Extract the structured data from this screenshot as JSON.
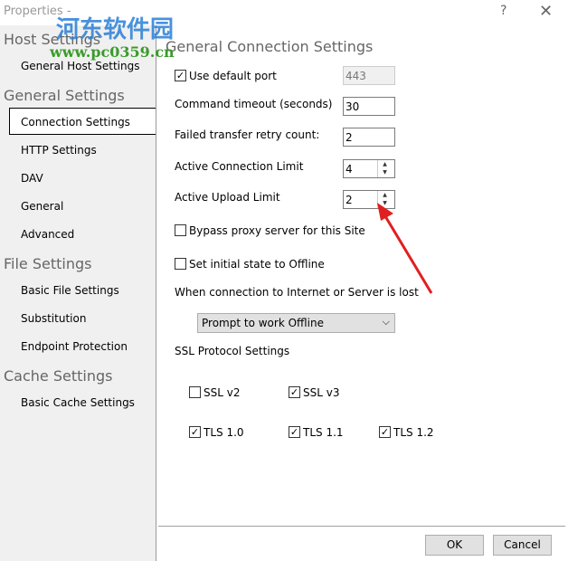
{
  "window": {
    "title": "Properties -",
    "help": "?",
    "close": "✕"
  },
  "watermark": {
    "text": "河东软件园",
    "url": "www.pc0359.cn"
  },
  "sidebar": {
    "groups": [
      {
        "label": "Host Settings",
        "items": [
          "General Host Settings"
        ]
      },
      {
        "label": "General Settings",
        "items": [
          "Connection Settings",
          "HTTP Settings",
          "DAV",
          "General",
          "Advanced"
        ]
      },
      {
        "label": "File Settings",
        "items": [
          "Basic File Settings",
          "Substitution",
          "Endpoint Protection"
        ]
      },
      {
        "label": "Cache Settings",
        "items": [
          "Basic Cache Settings"
        ]
      }
    ],
    "selected": "Connection Settings"
  },
  "main": {
    "heading": "General Connection Settings",
    "use_default_port": {
      "label": "Use default port",
      "checked": true,
      "value": "443"
    },
    "command_timeout": {
      "label": "Command timeout (seconds)",
      "value": "30"
    },
    "retry_count": {
      "label": "Failed transfer retry count:",
      "value": "2"
    },
    "connection_limit": {
      "label": "Active Connection Limit",
      "value": "4"
    },
    "upload_limit": {
      "label": "Active Upload Limit",
      "value": "2"
    },
    "bypass_proxy": {
      "label": "Bypass proxy server for this Site",
      "checked": false
    },
    "offline": {
      "label": "Set initial state to Offline",
      "checked": false
    },
    "lost_label": "When connection to Internet or Server is lost",
    "lost_select": "Prompt to work Offline",
    "ssl_heading": "SSL Protocol Settings",
    "ssl": [
      {
        "label": "SSL v2",
        "checked": false
      },
      {
        "label": "SSL v3",
        "checked": true
      },
      {
        "label": "TLS 1.0",
        "checked": true
      },
      {
        "label": "TLS 1.1",
        "checked": true
      },
      {
        "label": "TLS 1.2",
        "checked": true
      }
    ]
  },
  "buttons": {
    "ok": "OK",
    "cancel": "Cancel"
  },
  "colors": {
    "arrow": "#e02020"
  }
}
